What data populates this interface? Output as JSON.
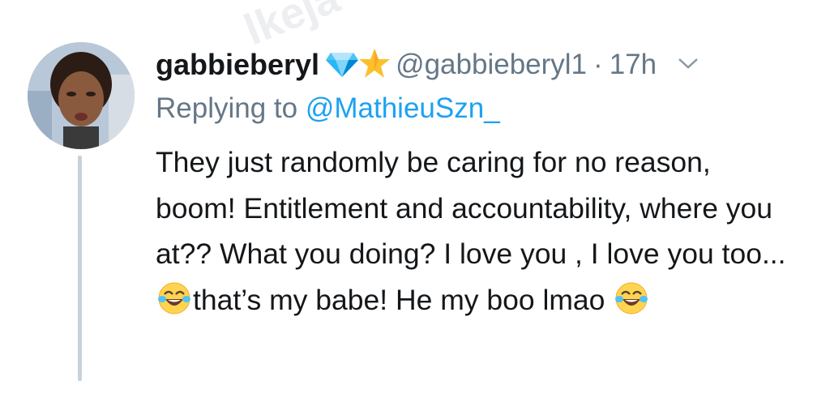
{
  "tweet": {
    "display_name": "gabbieberyl",
    "badges": [
      "diamond-icon",
      "star-icon"
    ],
    "handle": "@gabbieberyl1",
    "separator": "·",
    "time": "17h",
    "menu_icon": "chevron-down-icon",
    "reply": {
      "prefix": "Replying to",
      "mention": "@MathieuSzn_"
    },
    "text_segments": {
      "part1": "They just randomly be caring for no reason, boom! Entitlement and accountability, where you at?? What you doing? I love you , I love you too...",
      "part2": "that’s my babe! He my boo lmao",
      "emoji": "face-with-tears-of-joy-icon"
    },
    "watermark": "lkeja"
  },
  "colors": {
    "text": "#14171a",
    "muted": "#657786",
    "link": "#1da1f2",
    "thread_line": "#c9d1d9"
  }
}
